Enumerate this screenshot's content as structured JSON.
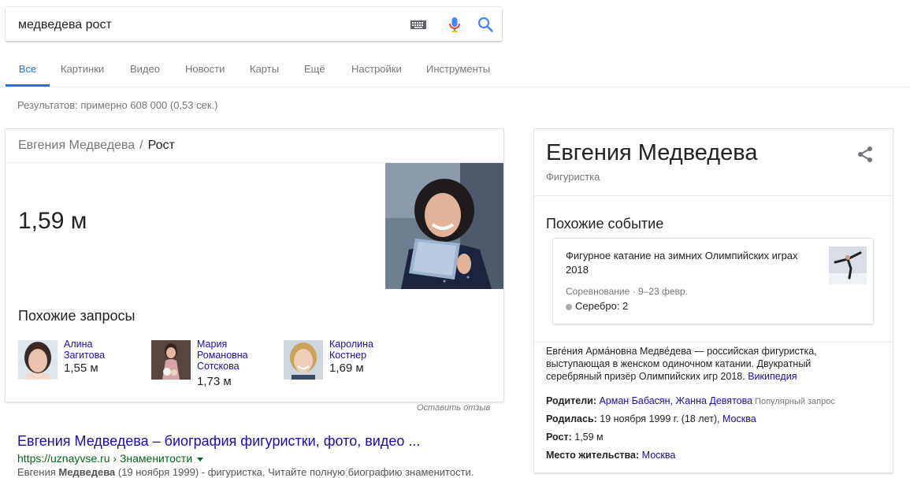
{
  "search": {
    "query": "медведева рост"
  },
  "tabs": [
    "Все",
    "Картинки",
    "Видео",
    "Новости",
    "Карты",
    "Ещё",
    "Настройки",
    "Инструменты"
  ],
  "results_count": "Результатов: примерно 608 000 (0,53 сек.)",
  "answer": {
    "breadcrumb_person": "Евгения Медведева",
    "breadcrumb_sep": "/",
    "breadcrumb_attr": "Рост",
    "value": "1,59 м",
    "related_title": "Похожие запросы",
    "related": [
      {
        "name": "Алина Загитова",
        "value": "1,55 м"
      },
      {
        "name": "Мария Романовна Сотскова",
        "value": "1,73 м"
      },
      {
        "name": "Каролина Костнер",
        "value": "1,69 м"
      }
    ],
    "feedback": "Оставить отзыв"
  },
  "result": {
    "title": "Евгения Медведева – биография фигуристки, фото, видео ...",
    "url": "https://uznayvse.ru › Знаменитости",
    "snippet_pre": "Евгения ",
    "snippet_bold": "Медведева",
    "snippet_post": " (19 ноября 1999) - фигуристка. Читайте полную биографию знаменитости."
  },
  "knowledge_panel": {
    "title": "Евгения Медведева",
    "subtitle": "Фигуристка",
    "similar_title": "Похожие событие",
    "event": {
      "title": "Фигурное катание на зимних Олимпийских играх 2018",
      "meta": "Соревнование · 9–23 февр.",
      "medal": "Серебро: 2"
    },
    "description": "Евге́ния Арма́новна Медве́дева — российская фигуристка, выступающая в женском одиночном катании. Двукратный серебряный призёр Олимпийских игр 2018.",
    "wiki_link": "Википедия",
    "facts": {
      "parents_label": "Родители:",
      "parents_value": "Арман Бабасян, Жанна Девятова",
      "parents_note": "Популярный запрос",
      "born_label": "Родилась:",
      "born_value": "19 ноября 1999 г. (18 лет),",
      "born_place": "Москва",
      "height_label": "Рост:",
      "height_value": "1,59 м",
      "residence_label": "Место жительства:",
      "residence_value": "Москва"
    }
  },
  "colors": {
    "accent": "#1a73e8",
    "link": "#1a0dab",
    "url": "#006621"
  }
}
